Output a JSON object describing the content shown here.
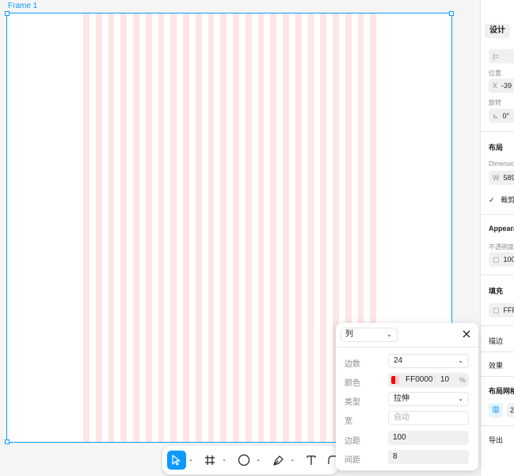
{
  "frame": {
    "label": "Frame 1"
  },
  "grid": {
    "count": 24,
    "color": "#ff0000",
    "opacity": 0.1,
    "type": "stretch",
    "margin": 100,
    "gutter": 8
  },
  "panel": {
    "tab_design": "设计",
    "label_position": "位置",
    "pos_x_prefix": "X",
    "pos_x_value": "-39",
    "label_rotation": "旋转",
    "rotation_value": "0°",
    "section_layout": "布局",
    "label_dimensions": "Dimensio",
    "width_prefix": "W",
    "width_value": "589",
    "clip_label": "裁剪",
    "section_appearance": "Appeara",
    "label_opacity": "不透明度",
    "opacity_value": "100",
    "section_fill": "填充",
    "fill_value": "FFF",
    "section_stroke": "描边",
    "section_effects": "效果",
    "section_layout_grid": "布局网格",
    "layout_grid_value": "2",
    "section_export": "导出"
  },
  "popup": {
    "type_value": "列",
    "count_label": "边数",
    "count_value": "24",
    "color_label": "颜色",
    "color_hex": "FF0000",
    "color_opacity": "10",
    "color_pct": "%",
    "kind_label": "类型",
    "kind_value": "拉伸",
    "width_label": "宽",
    "width_placeholder": "自动",
    "margin_label": "边距",
    "margin_value": "100",
    "gutter_label": "间距",
    "gutter_value": "8"
  },
  "colors": {
    "accent": "#0d99ff",
    "grid_column": "#ff0000"
  },
  "icons": [
    "move-tool-icon",
    "frame-tool-icon",
    "ellipse-tool-icon",
    "pen-tool-icon",
    "text-tool-icon",
    "shape-tool-icon",
    "close-icon",
    "chevron-down-icon",
    "checkmark-icon",
    "column-grid-icon"
  ]
}
